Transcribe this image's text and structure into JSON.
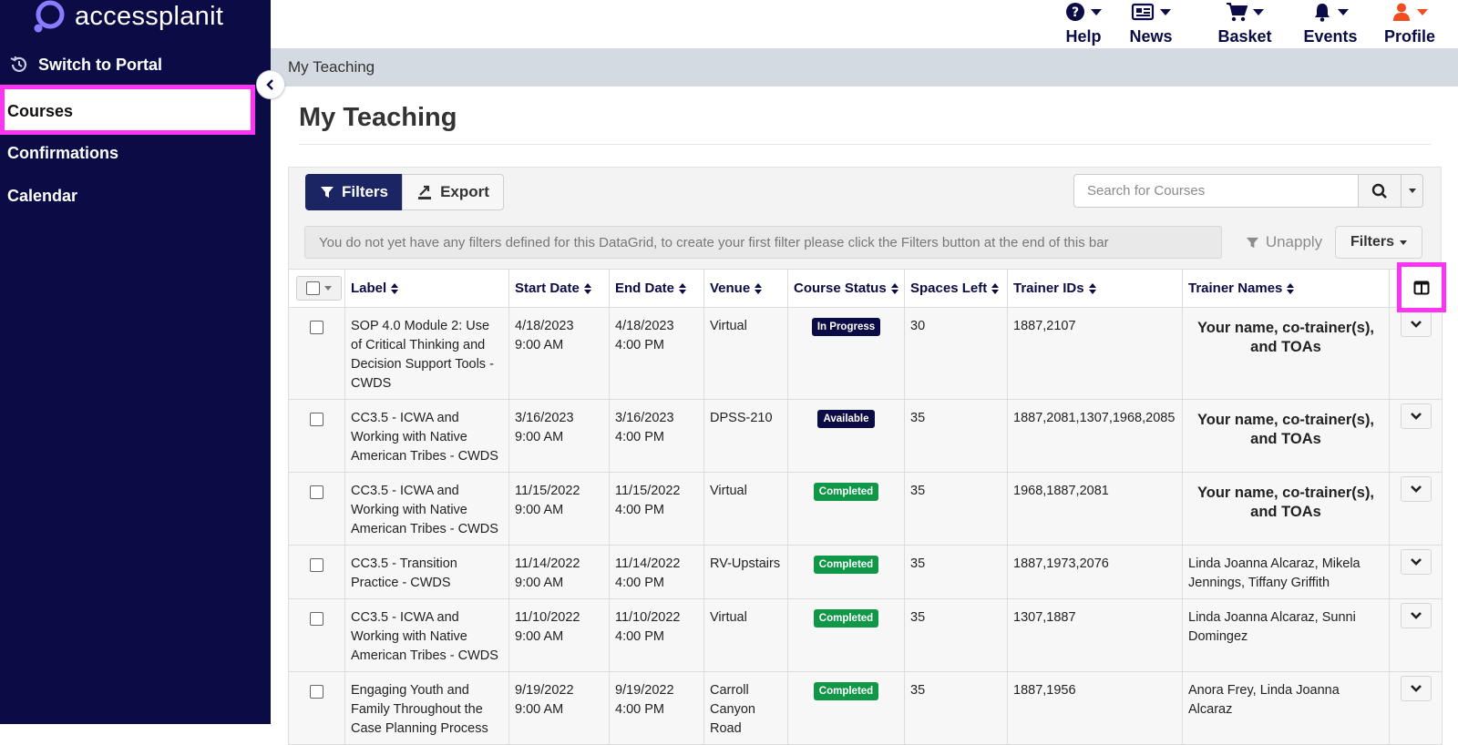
{
  "app": {
    "brand": "accessplanit"
  },
  "sidebar": {
    "switch_portal": "Switch to Portal",
    "items": [
      {
        "label": "Courses",
        "active": true
      },
      {
        "label": "Confirmations"
      },
      {
        "label": "Calendar"
      }
    ]
  },
  "topnav": {
    "items": [
      {
        "label": "Help",
        "icon": "help-circle-icon"
      },
      {
        "label": "News",
        "icon": "newspaper-icon"
      },
      {
        "label": "Basket",
        "icon": "cart-icon"
      },
      {
        "label": "Events",
        "icon": "bell-icon"
      },
      {
        "label": "Profile",
        "icon": "user-icon"
      }
    ]
  },
  "breadcrumb": "My Teaching",
  "page": {
    "title": "My Teaching"
  },
  "toolbar": {
    "filters_label": "Filters",
    "export_label": "Export",
    "search_placeholder": "Search for Courses"
  },
  "filter_bar": {
    "message": "You do not yet have any filters defined for this DataGrid, to create your first filter please click the Filters button at the end of this bar",
    "unapply_label": "Unapply",
    "filters_label": "Filters"
  },
  "table": {
    "columns": [
      "Label",
      "Start Date",
      "End Date",
      "Venue",
      "Course Status",
      "Spaces Left",
      "Trainer IDs",
      "Trainer Names"
    ],
    "rows": [
      {
        "label": "SOP 4.0 Module 2: Use of Critical Thinking and Decision Support Tools - CWDS",
        "start_date": "4/18/2023",
        "start_time": "9:00 AM",
        "end_date": "4/18/2023",
        "end_time": "4:00 PM",
        "venue": "Virtual",
        "status": "In Progress",
        "spaces_left": "30",
        "trainer_ids": "1887,2107",
        "trainer_names": "Your name, co-trainer(s), and TOAs"
      },
      {
        "label": "CC3.5 - ICWA and Working with Native American Tribes - CWDS",
        "start_date": "3/16/2023",
        "start_time": "9:00 AM",
        "end_date": "3/16/2023",
        "end_time": "4:00 PM",
        "venue": "DPSS-210",
        "status": "Available",
        "spaces_left": "35",
        "trainer_ids": "1887,2081,1307,1968,2085",
        "trainer_names": "Your name, co-trainer(s), and TOAs"
      },
      {
        "label": "CC3.5 - ICWA and Working with Native American Tribes - CWDS",
        "start_date": "11/15/2022",
        "start_time": "9:00 AM",
        "end_date": "11/15/2022",
        "end_time": "4:00 PM",
        "venue": "Virtual",
        "status": "Completed",
        "spaces_left": "35",
        "trainer_ids": "1968,1887,2081",
        "trainer_names": "Your name, co-trainer(s), and TOAs"
      },
      {
        "label": "CC3.5 - Transition Practice - CWDS",
        "start_date": "11/14/2022",
        "start_time": "9:00 AM",
        "end_date": "11/14/2022",
        "end_time": "4:00 PM",
        "venue": "RV-Upstairs",
        "status": "Completed",
        "spaces_left": "35",
        "trainer_ids": "1887,1973,2076",
        "trainer_names": "Linda Joanna Alcaraz, Mikela Jennings, Tiffany Griffith"
      },
      {
        "label": "CC3.5 - ICWA and Working with Native American Tribes - CWDS",
        "start_date": "11/10/2022",
        "start_time": "9:00 AM",
        "end_date": "11/10/2022",
        "end_time": "4:00 PM",
        "venue": "Virtual",
        "status": "Completed",
        "spaces_left": "35",
        "trainer_ids": "1307,1887",
        "trainer_names": "Linda Joanna Alcaraz, Sunni Domingez"
      },
      {
        "label": "Engaging Youth and Family Throughout the Case Planning Process",
        "start_date": "9/19/2022",
        "start_time": "9:00 AM",
        "end_date": "9/19/2022",
        "end_time": "4:00 PM",
        "venue": "Carroll Canyon Road",
        "status": "Completed",
        "spaces_left": "35",
        "trainer_ids": "1887,1956",
        "trainer_names": "Anora Frey, Linda Joanna Alcaraz"
      }
    ]
  },
  "colors": {
    "sidebar_bg": "#0b0b45",
    "highlight": "#ff33f3",
    "in_progress": "#0b0b45",
    "available": "#0b0b45",
    "completed": "#109748",
    "profile_accent": "#f04d23"
  }
}
